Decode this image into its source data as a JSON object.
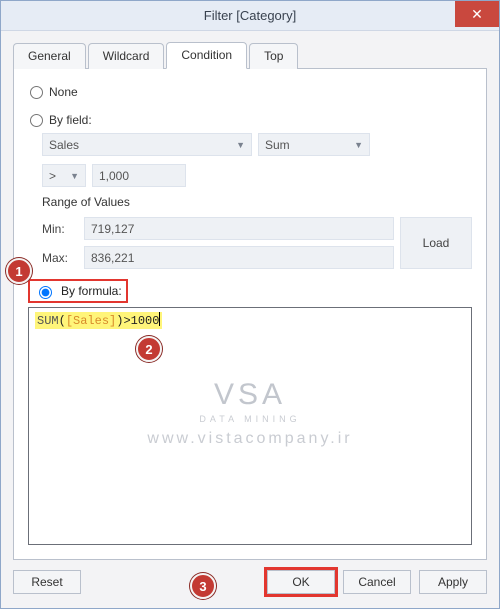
{
  "window": {
    "title": "Filter [Category]"
  },
  "tabs": {
    "general": "General",
    "wildcard": "Wildcard",
    "condition": "Condition",
    "top": "Top"
  },
  "radios": {
    "none": "None",
    "byfield": "By field:",
    "byformula": "By formula:"
  },
  "byfield": {
    "field": "Sales",
    "agg": "Sum",
    "op": ">",
    "value": "1,000",
    "range_label": "Range of Values",
    "min_label": "Min:",
    "min_value": "719,127",
    "max_label": "Max:",
    "max_value": "836,221",
    "load": "Load"
  },
  "formula": {
    "fn": "SUM",
    "open": "(",
    "field": "[Sales]",
    "close": ")",
    "rest": ">1000"
  },
  "watermark": {
    "logo": "VSA",
    "sub": "DATA MINING",
    "url": "www.vistacompany.ir"
  },
  "buttons": {
    "reset": "Reset",
    "ok": "OK",
    "cancel": "Cancel",
    "apply": "Apply"
  },
  "callouts": {
    "c1": "1",
    "c2": "2",
    "c3": "3"
  }
}
